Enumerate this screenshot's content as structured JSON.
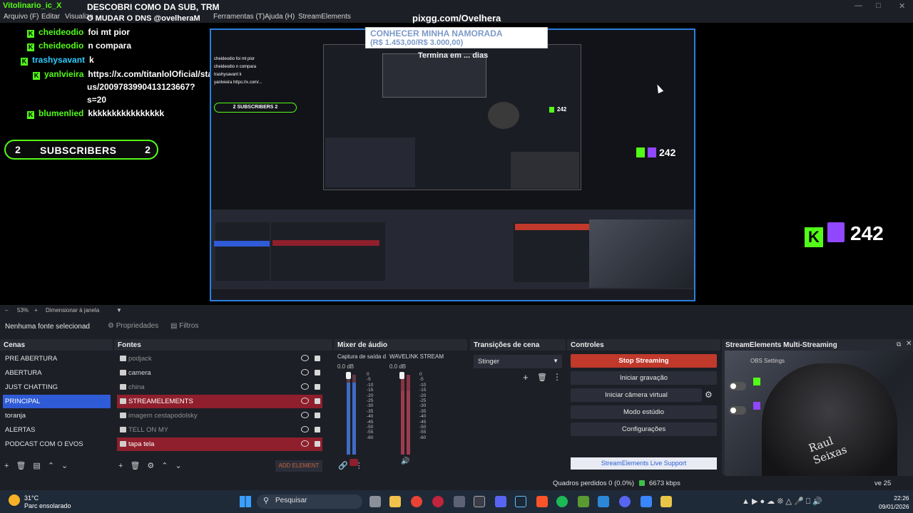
{
  "window": {
    "title_partial": "Vitolinario_ic_X"
  },
  "menu": {
    "items": [
      "Arquivo (F)",
      "Editar",
      "Visualiza",
      "Ferramentas (T)",
      "Ajuda (H)",
      "StreamElements"
    ]
  },
  "overlay": {
    "title": "DESCOBRI COMO DA SUB, TRM",
    "title2": "O MUDAR O DNS @ovelheraM",
    "pix": "pixgg.com/Ovelhera",
    "chat": [
      {
        "user": "cheideodio",
        "msg": "foi mt pior",
        "color": "green"
      },
      {
        "user": "cheideodio",
        "msg": "n compara",
        "color": "green"
      },
      {
        "user": "trashysavant",
        "msg": "k",
        "color": "blue"
      },
      {
        "user": "yanlvieira",
        "msg": "https://x.com/titanlolOficial/stat",
        "color": "green"
      },
      {
        "user": "",
        "msg": "us/2009783990413123667?",
        "color": "none"
      },
      {
        "user": "",
        "msg": "s=20",
        "color": "none"
      },
      {
        "user": "blumenlied",
        "msg": "kkkkkkkkkkkkkkkk",
        "color": "green"
      }
    ],
    "subs_left": "2",
    "subs_label": "SUBSCRIBERS",
    "subs_right": "2",
    "goal_title": "CONHECER MINHA NAMORADA",
    "goal_amount": "(R$ 1.453,00/R$ 3.000,00)",
    "goal_time": "Termina em ... dias",
    "viewers_small": "242",
    "viewers_big": "242"
  },
  "zoombar": {
    "zoom": "53%",
    "fit": "Dimensionar à janela"
  },
  "toolbar": {
    "no_source": "Nenhuma fonte selecionad",
    "properties": "Propriedades",
    "filters": "Filtros"
  },
  "scenes": {
    "title": "Cenas",
    "items": [
      "PRE ABERTURA",
      "ABERTURA",
      "JUST CHATTING",
      "PRINCIPAL",
      "toranja",
      "ALERTAS",
      "PODCAST COM O EVOS"
    ],
    "selected": "PRINCIPAL"
  },
  "sources": {
    "title": "Fontes",
    "items": [
      {
        "name": "podjack",
        "state": "dim"
      },
      {
        "name": "camera",
        "state": "normal"
      },
      {
        "name": "china",
        "state": "dim"
      },
      {
        "name": "STREAMELEMENTS",
        "state": "hl"
      },
      {
        "name": "imagem cestapodolsky",
        "state": "dim"
      },
      {
        "name": "TELL ON MY",
        "state": "dim"
      },
      {
        "name": "tapa tela",
        "state": "hl"
      }
    ],
    "add_label": "ADD ELEMENT"
  },
  "mixer": {
    "title": "Mixer de áudio",
    "ch1_label": "Captura de saída d",
    "ch1_db": "0.0 dB",
    "ch2_label": "WAVELINK STREAM",
    "ch2_db": "0.0 dB",
    "scale": [
      "0",
      "-5",
      "-10",
      "-15",
      "-20",
      "-25",
      "-30",
      "-35",
      "-40",
      "-45",
      "-50",
      "-55",
      "-60"
    ]
  },
  "transitions": {
    "title": "Transições de cena",
    "selected": "Stinger"
  },
  "controls": {
    "title": "Controles",
    "stop": "Stop Streaming",
    "record": "Iniciar gravação",
    "vcam": "Iniciar câmera virtual",
    "studio": "Modo estúdio",
    "settings": "Configurações",
    "se_support": "StreamElements Live Support"
  },
  "multistream": {
    "title": "StreamElements Multi-Streaming",
    "obs_settings": "OBS Settings",
    "shirt": "Raul\nSeixas"
  },
  "status": {
    "dropped": "Quadros perdidos 0 (0.0%)",
    "kbps": "6673 kbps",
    "stream_time": "ve 25"
  },
  "taskbar": {
    "temp": "31°C",
    "condition": "Parc ensolarado",
    "search": "Pesquisar",
    "time": "22:26",
    "date": "09/01/2026"
  },
  "colors": {
    "kick_green": "#53fc18",
    "twitch_purple": "#9146ff",
    "selected_blue": "#2f5bd7",
    "stop_red": "#c0392b",
    "source_highlight": "#8f1f2c"
  }
}
